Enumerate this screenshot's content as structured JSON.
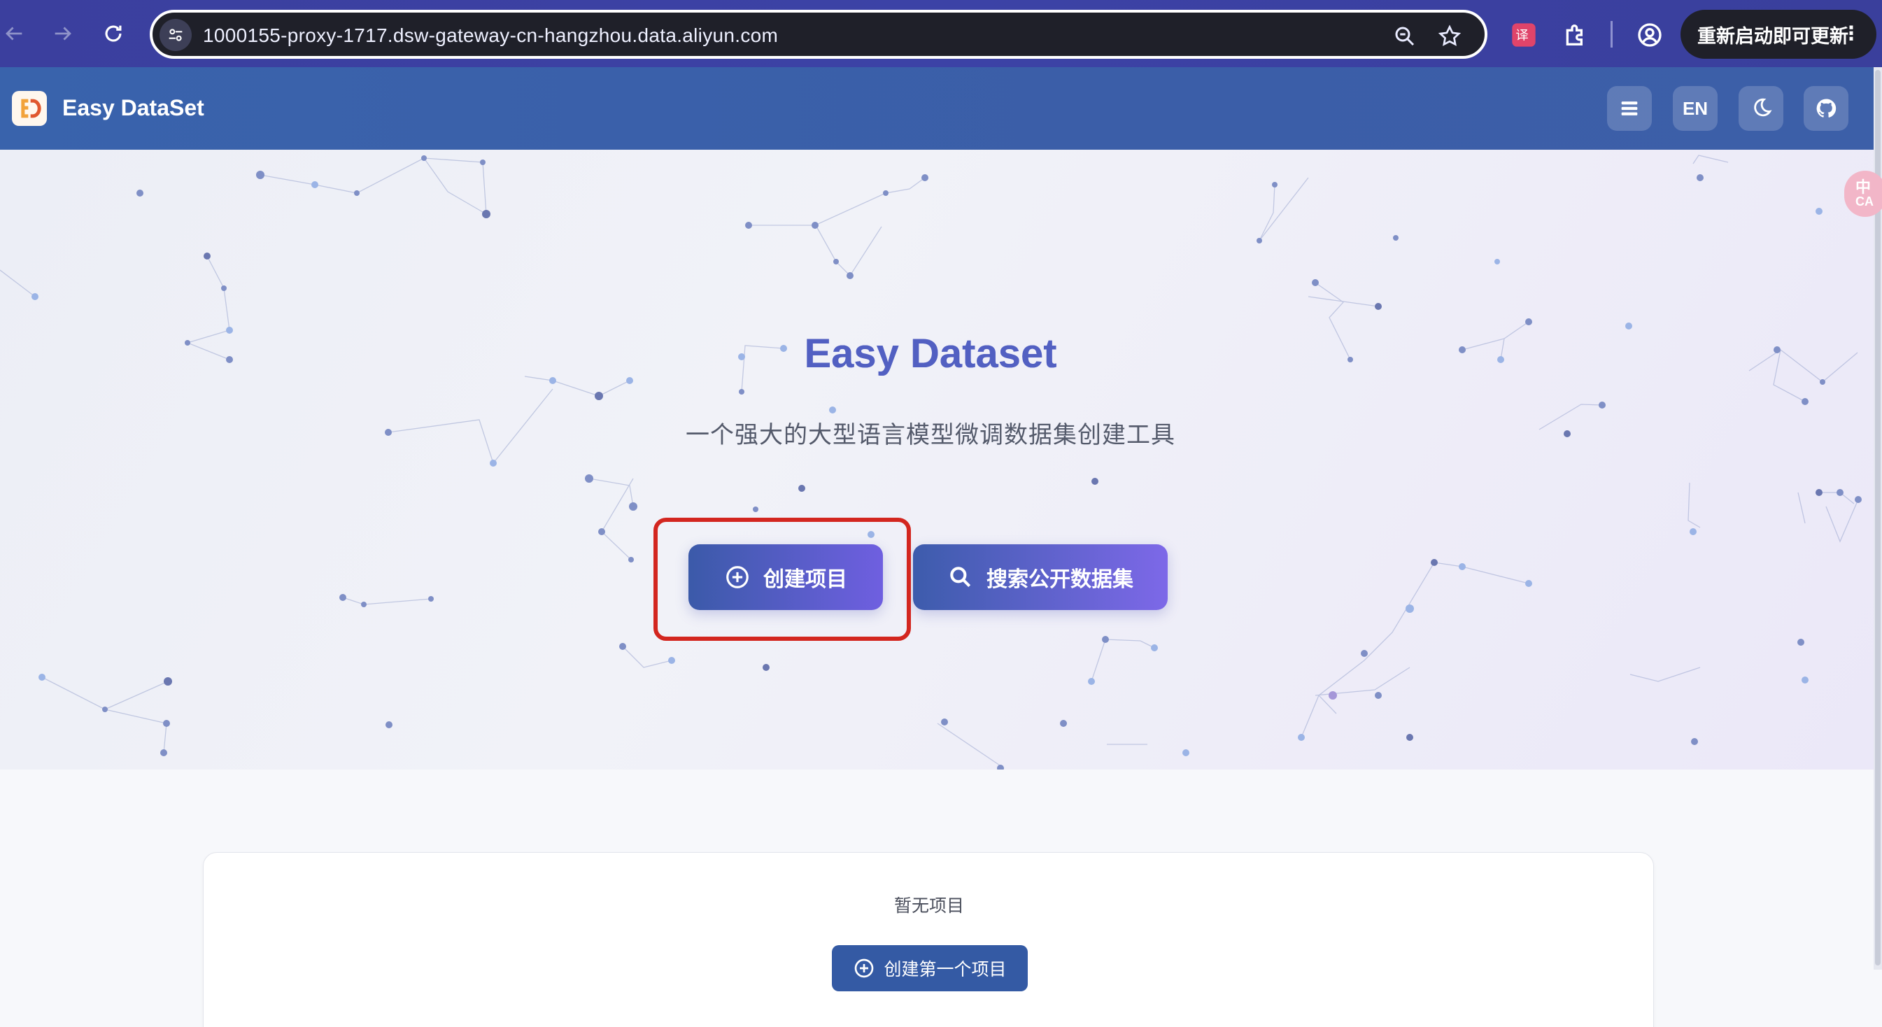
{
  "browser": {
    "url": "1000155-proxy-1717.dsw-gateway-cn-hangzhou.data.aliyun.com",
    "update_label": "重新启动即可更新"
  },
  "header": {
    "title": "Easy DataSet",
    "language_label": "EN"
  },
  "hero": {
    "title": "Easy Dataset",
    "subtitle": "一个强大的大型语言模型微调数据集创建工具",
    "create_label": "创建项目",
    "search_label": "搜索公开数据集"
  },
  "side_badge": {
    "line1": "中",
    "line2": "CA"
  },
  "projects": {
    "empty_text": "暂无项目",
    "create_first_label": "创建第一个项目"
  },
  "colors": {
    "accent": "#3b5aa9",
    "accent_end": "#7d68e8",
    "highlight": "#d3261f",
    "header": "#3963ac"
  }
}
